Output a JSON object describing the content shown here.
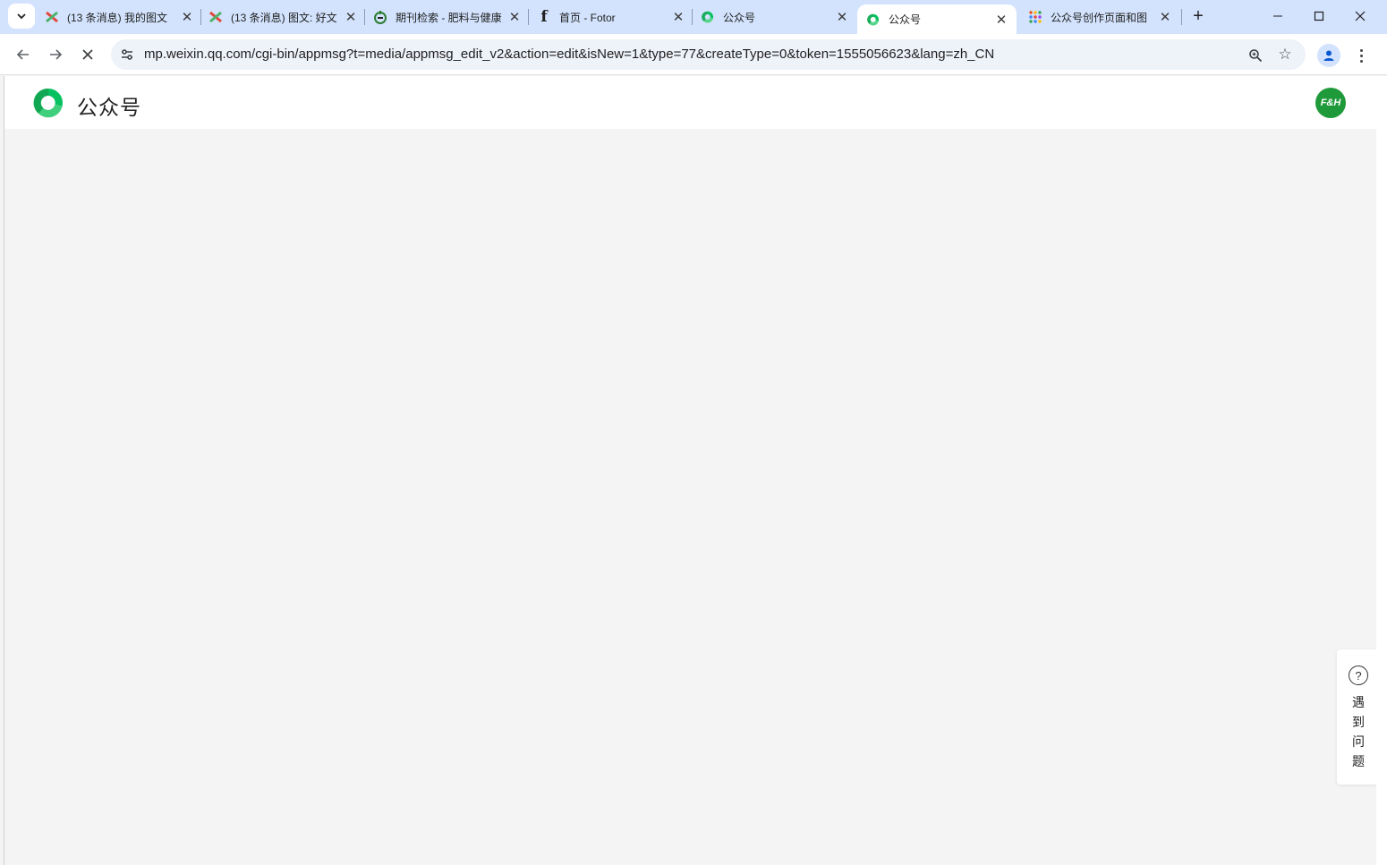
{
  "browser": {
    "tabs": [
      {
        "title": "(13 条消息) 我的图文",
        "favicon": "csdn-icon",
        "active": false
      },
      {
        "title": "(13 条消息) 图文: 好文",
        "favicon": "csdn-icon",
        "active": false
      },
      {
        "title": "期刊检索 - 肥料与健康",
        "favicon": "journal-icon",
        "active": false
      },
      {
        "title": "首页 - Fotor",
        "favicon": "fotor-icon",
        "active": false
      },
      {
        "title": "公众号",
        "favicon": "wechat-mp-icon",
        "active": false
      },
      {
        "title": "公众号",
        "favicon": "wechat-mp-icon",
        "active": true
      },
      {
        "title": "公众号创作页面和图",
        "favicon": "grid-app-icon",
        "active": false
      }
    ],
    "url": "mp.weixin.qq.com/cgi-bin/appmsg?t=media/appmsg_edit_v2&action=edit&isNew=1&type=77&createType=0&token=1555056623&lang=zh_CN",
    "loading": true
  },
  "page": {
    "brand": "公众号",
    "avatar_text": "F&H",
    "help_label": "遇\n到\n问\n题",
    "help_label_chars": [
      "遇",
      "到",
      "问",
      "题"
    ]
  },
  "colors": {
    "tabstrip": "#d3e3fd",
    "page_bg": "#f4f4f4",
    "brand_green": "#07c160",
    "avatar_green": "#1f9a3a"
  }
}
